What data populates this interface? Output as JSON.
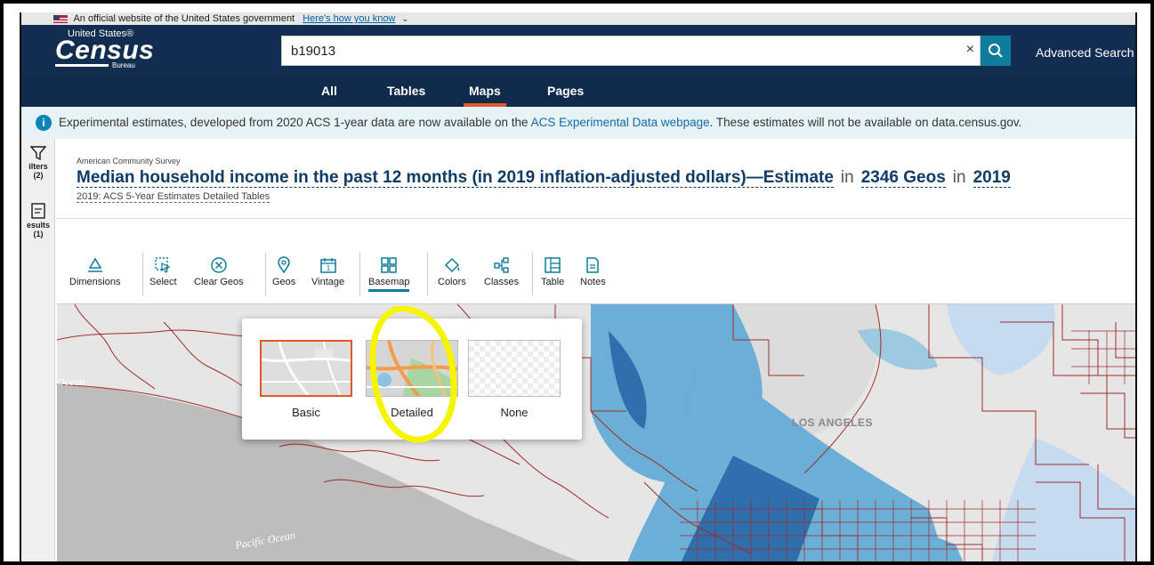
{
  "gov_banner": {
    "text": "An official website of the United States government",
    "link": "Here's how you know"
  },
  "header": {
    "logo_top": "United States®",
    "logo_main": "Census",
    "logo_bottom": "Bureau",
    "search_value": "b19013",
    "clear_icon": "×",
    "advanced_search": "Advanced Search"
  },
  "tabs": [
    {
      "label": "All",
      "active": false
    },
    {
      "label": "Tables",
      "active": false
    },
    {
      "label": "Maps",
      "active": true
    },
    {
      "label": "Pages",
      "active": false
    }
  ],
  "info_bar": {
    "text_before": "Experimental estimates, developed from 2020 ACS 1-year data are now available on the ",
    "link": "ACS Experimental Data webpage",
    "text_after": ". These estimates will not be available on data.census.gov."
  },
  "rail": {
    "filters_label": "ilters",
    "filters_count": "(2)",
    "results_label": "esults",
    "results_count": "(1)"
  },
  "title_area": {
    "survey": "American Community Survey",
    "title": "Median household income in the past 12 months (in 2019 inflation-adjusted dollars)—Estimate",
    "in1": "in",
    "geos": "2346 Geos",
    "in2": "in",
    "year": "2019",
    "subtitle": "2019: ACS 5-Year Estimates Detailed Tables"
  },
  "toolbar": {
    "dimensions": "Dimensions",
    "select": "Select",
    "clear_geos": "Clear Geos",
    "geos": "Geos",
    "vintage": "Vintage",
    "basemap": "Basemap",
    "colors": "Colors",
    "classes": "Classes",
    "table": "Table",
    "notes": "Notes",
    "vintage_icon_text": "1"
  },
  "map": {
    "label_ocean": "Ocean",
    "label_pacific": "Pacific Ocean",
    "label_city": "LOS ANGELES",
    "colors": {
      "light": "#c6dbef",
      "mid": "#6baed6",
      "dark": "#2f6fae",
      "boundary": "#a02b2b",
      "land": "#e6e6e6",
      "water": "#bdbdbd"
    }
  },
  "basemap_popup": {
    "options": [
      {
        "label": "Basic",
        "selected": true
      },
      {
        "label": "Detailed",
        "selected": false
      },
      {
        "label": "None",
        "selected": false
      }
    ]
  },
  "colors": {
    "header_bg": "#112e51",
    "accent": "#e0592a",
    "teal": "#0e7c9a",
    "highlight": "#f5f500"
  }
}
